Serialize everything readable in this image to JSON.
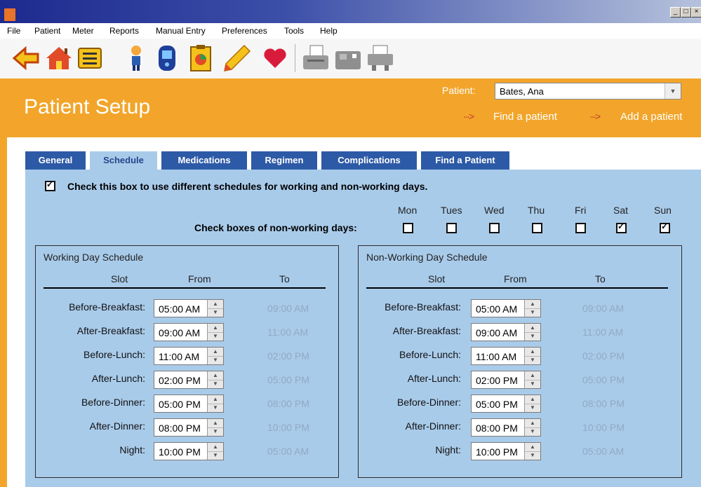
{
  "menu": {
    "items": [
      "File",
      "Patient",
      "Meter",
      "Reports",
      "Manual Entry",
      "Preferences",
      "Tools",
      "Help"
    ]
  },
  "window": {
    "minimize_glyph": "_",
    "maximize_glyph": "□",
    "close_glyph": "×"
  },
  "toolbar": {
    "icons": [
      "back-arrow-icon",
      "home-icon",
      "patient-list-icon",
      "person-icon",
      "glucose-meter-icon",
      "clipboard-chart-icon",
      "pencil-icon",
      "heart-icon",
      "printer-icon",
      "meter-cradle-icon",
      "fax-icon"
    ]
  },
  "header": {
    "title": "Patient Setup",
    "patient_label": "Patient:",
    "patient_value": "Bates, Ana",
    "find_link": "Find a patient",
    "add_link": "Add a patient",
    "link_arrow": "···>",
    "dropdown_arrow": "▼"
  },
  "tabs": [
    {
      "label": "General",
      "active": false
    },
    {
      "label": "Schedule",
      "active": true
    },
    {
      "label": "Medications",
      "active": false
    },
    {
      "label": "Regimen",
      "active": false
    },
    {
      "label": "Complications",
      "active": false
    },
    {
      "label": "Find a Patient",
      "active": false
    }
  ],
  "schedule": {
    "different_schedules_text": "Check this box to use different schedules for working and non-working days.",
    "different_schedules_checked": true,
    "check_glyph": "✓",
    "nonworking_text": "Check boxes of non-working days:",
    "days": [
      {
        "label": "Mon",
        "checked": false
      },
      {
        "label": "Tues",
        "checked": false
      },
      {
        "label": "Wed",
        "checked": false
      },
      {
        "label": "Thu",
        "checked": false
      },
      {
        "label": "Fri",
        "checked": false
      },
      {
        "label": "Sat",
        "checked": true
      },
      {
        "label": "Sun",
        "checked": true
      }
    ],
    "columns": {
      "slot": "Slot",
      "from": "From",
      "to": "To"
    },
    "spin_up": "▲",
    "spin_down": "▼",
    "working": {
      "title": "Working Day Schedule",
      "rows": [
        {
          "slot": "Before-Breakfast:",
          "from": "05:00  AM",
          "to": "09:00  AM"
        },
        {
          "slot": "After-Breakfast:",
          "from": "09:00  AM",
          "to": "11:00  AM"
        },
        {
          "slot": "Before-Lunch:",
          "from": "11:00  AM",
          "to": "02:00  PM"
        },
        {
          "slot": "After-Lunch:",
          "from": "02:00  PM",
          "to": "05:00  PM"
        },
        {
          "slot": "Before-Dinner:",
          "from": "05:00  PM",
          "to": "08:00  PM"
        },
        {
          "slot": "After-Dinner:",
          "from": "08:00  PM",
          "to": "10:00  PM"
        },
        {
          "slot": "Night:",
          "from": "10:00  PM",
          "to": "05:00  AM"
        }
      ]
    },
    "nonworking": {
      "title": "Non-Working Day Schedule",
      "rows": [
        {
          "slot": "Before-Breakfast:",
          "from": "05:00  AM",
          "to": "09:00  AM"
        },
        {
          "slot": "After-Breakfast:",
          "from": "09:00  AM",
          "to": "11:00  AM"
        },
        {
          "slot": "Before-Lunch:",
          "from": "11:00  AM",
          "to": "02:00  PM"
        },
        {
          "slot": "After-Lunch:",
          "from": "02:00  PM",
          "to": "05:00  PM"
        },
        {
          "slot": "Before-Dinner:",
          "from": "05:00  PM",
          "to": "08:00  PM"
        },
        {
          "slot": "After-Dinner:",
          "from": "08:00  PM",
          "to": "10:00  PM"
        },
        {
          "slot": "Night:",
          "from": "10:00  PM",
          "to": "05:00  AM"
        }
      ]
    }
  },
  "colors": {
    "header_orange": "#f2a52a",
    "tab_blue": "#2d5aa6",
    "panel_blue": "#a9cbea",
    "link_arrow_red": "#c0392b"
  }
}
